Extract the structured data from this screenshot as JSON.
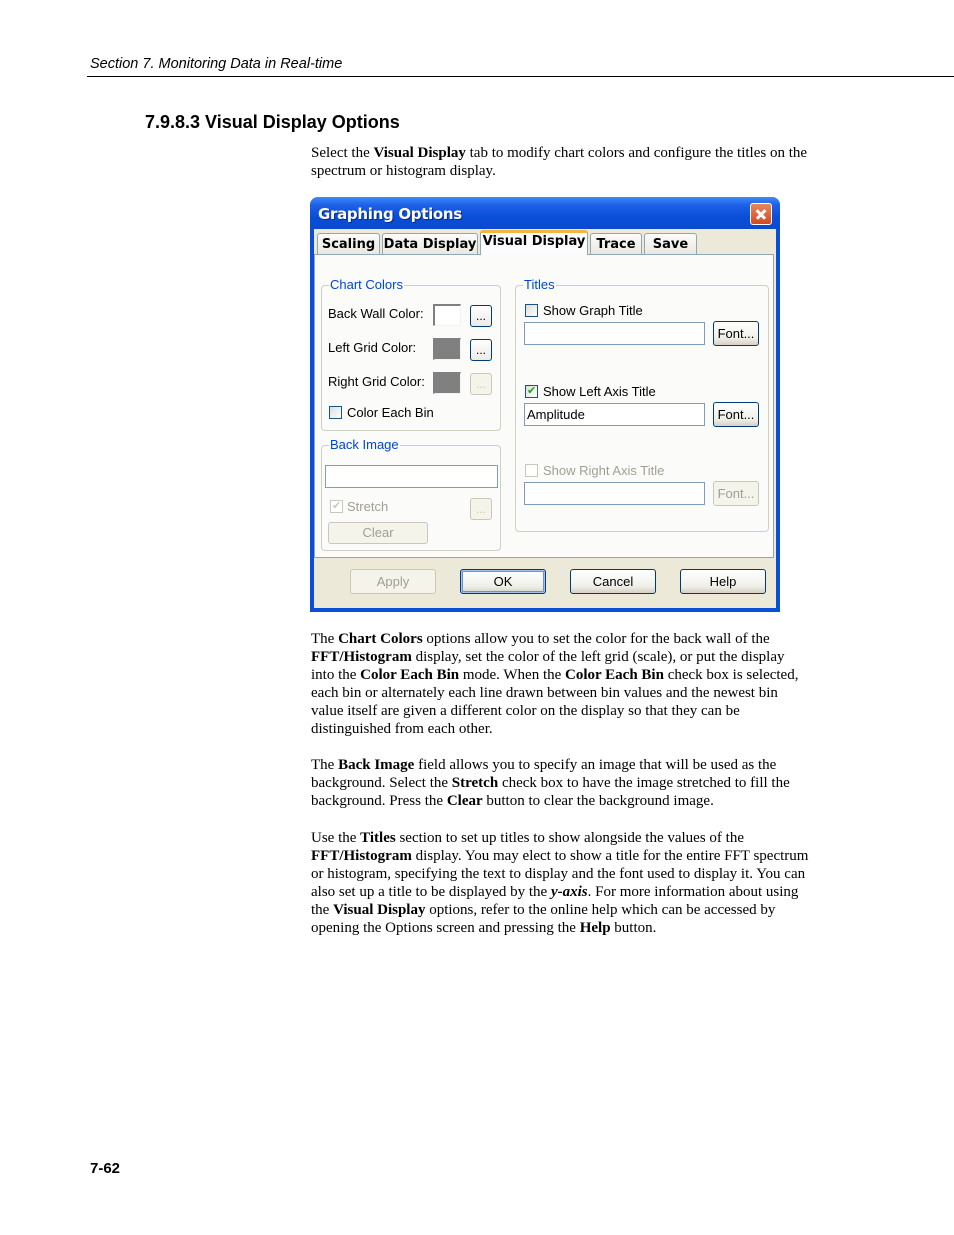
{
  "page": {
    "running_head": "Section 7.  Monitoring Data in Real-time",
    "section_title": "7.9.8.3  Visual Display Options",
    "page_number": "7-62"
  },
  "intro": {
    "t1": "Select the ",
    "b1": "Visual Display",
    "t2": " tab to modify chart colors and configure the titles on the spectrum or histogram display."
  },
  "dialog": {
    "title": "Graphing Options",
    "tabs": [
      {
        "label": "Scaling",
        "active": false
      },
      {
        "label": "Data Display",
        "active": false
      },
      {
        "label": "Visual Display",
        "active": true
      },
      {
        "label": "Trace",
        "active": false
      },
      {
        "label": "Save",
        "active": false
      }
    ],
    "chart_colors": {
      "group_label": "Chart Colors",
      "back_wall_label": "Back Wall Color:",
      "back_wall_color": "#ffffff",
      "left_grid_label": "Left Grid Color:",
      "left_grid_color": "#808080",
      "right_grid_label": "Right Grid Color:",
      "right_grid_color": "#808080",
      "browse_label": "...",
      "color_each_bin_label": "Color Each Bin",
      "color_each_bin_checked": false
    },
    "back_image": {
      "group_label": "Back Image",
      "path_value": "",
      "stretch_label": "Stretch",
      "stretch_checked": true,
      "browse_label": "...",
      "clear_label": "Clear"
    },
    "titles": {
      "group_label": "Titles",
      "show_graph_title_label": "Show Graph Title",
      "show_graph_title_checked": false,
      "graph_title_value": "",
      "show_left_axis_title_label": "Show Left Axis Title",
      "show_left_axis_title_checked": true,
      "left_axis_title_value": "Amplitude",
      "show_right_axis_title_label": "Show Right Axis Title",
      "show_right_axis_title_checked": false,
      "right_axis_title_value": "",
      "font_label": "Font...",
      "check_mark": "✔"
    },
    "buttons": {
      "apply": "Apply",
      "ok": "OK",
      "cancel": "Cancel",
      "help": "Help"
    }
  },
  "paragraphs": {
    "p1": {
      "t1": "The ",
      "b1": "Chart Colors",
      "t2": " options allow you to set the color for the back wall of the ",
      "b2": "FFT/Histogram",
      "t3": " display, set the color of the left grid (scale), or put the display into the ",
      "b3": "Color Each Bin",
      "t4": " mode.  When the ",
      "b4": "Color Each Bin",
      "t5": " check box is selected, each bin or alternately each line drawn between bin values and the newest bin value itself are given a different color on the display so that they can be distinguished from each other."
    },
    "p2": {
      "t1": "The ",
      "b1": "Back Image",
      "t2": " field allows you to specify an image that will be used as the background.  Select the ",
      "b2": "Stretch",
      "t3": " check box to have the image stretched to fill the background.  Press the ",
      "b3": "Clear",
      "t4": " button to clear the background image."
    },
    "p3": {
      "t1": "Use the ",
      "b1": "Titles",
      "t2": " section to set up titles to show alongside the values of the ",
      "b2": "FFT/Histogram",
      "t3": " display.  You may elect to show a title for the entire FFT spectrum or histogram, specifying the text to display and the font used to display it.  You can also set up a title to be displayed by the ",
      "i1": "y-axis",
      "t4": ".  For more information about using the ",
      "b3": "Visual Display",
      "t5": " options, refer to the online help which can be accessed by opening the Options screen and pressing the ",
      "b4": "Help",
      "t6": " button."
    }
  }
}
